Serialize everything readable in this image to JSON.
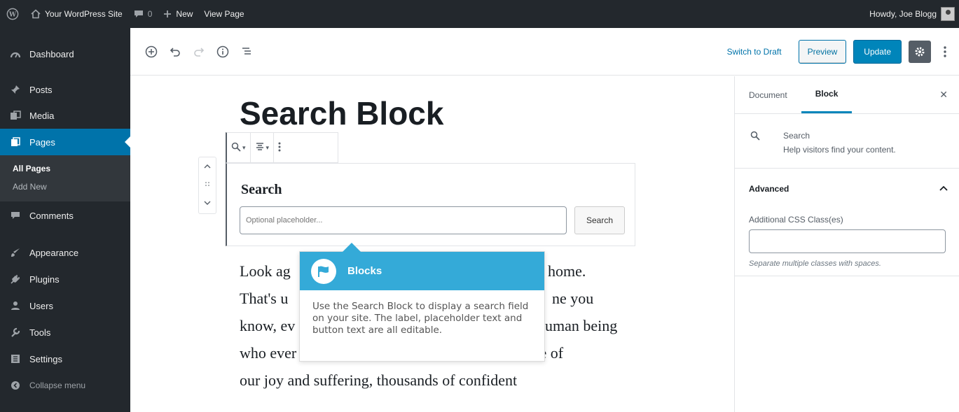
{
  "adminbar": {
    "site_name": "Your WordPress Site",
    "comments_count": "0",
    "new_label": "New",
    "view_page_label": "View Page",
    "howdy": "Howdy, Joe Blogg"
  },
  "sidebar": {
    "items": [
      {
        "label": "Dashboard",
        "icon": "dashboard-icon"
      },
      {
        "label": "Posts",
        "icon": "pin-icon"
      },
      {
        "label": "Media",
        "icon": "media-icon"
      },
      {
        "label": "Pages",
        "icon": "pages-icon"
      },
      {
        "label": "Comments",
        "icon": "comment-icon"
      },
      {
        "label": "Appearance",
        "icon": "brush-icon"
      },
      {
        "label": "Plugins",
        "icon": "plug-icon"
      },
      {
        "label": "Users",
        "icon": "users-icon"
      },
      {
        "label": "Tools",
        "icon": "wrench-icon"
      },
      {
        "label": "Settings",
        "icon": "settings-icon"
      }
    ],
    "submenu": [
      "All Pages",
      "Add New"
    ],
    "collapse_label": "Collapse menu"
  },
  "toolbar": {
    "switch_to_draft": "Switch to Draft",
    "preview": "Preview",
    "update": "Update"
  },
  "editor": {
    "title": "Search Block",
    "search_label": "Search",
    "search_placeholder": "Optional placeholder...",
    "search_button": "Search",
    "paragraph_lines": [
      "Look ag",
      "home.",
      "That's u",
      "ne you",
      "know, ev",
      "uman being",
      "who ever was, lived out their lives. The aggregate of",
      "our joy and suffering, thousands of confident"
    ]
  },
  "popover": {
    "title": "Blocks",
    "body": "Use the Search Block to display a search field on your site. The label, placeholder text and button text are all editable."
  },
  "settings": {
    "tab_document": "Document",
    "tab_block": "Block",
    "block_name": "Search",
    "block_description": "Help visitors find your content.",
    "advanced_title": "Advanced",
    "css_label": "Additional CSS Class(es)",
    "css_help": "Separate multiple classes with spaces."
  },
  "colors": {
    "admin_dark": "#23282d",
    "accent_blue": "#0073aa",
    "primary_button": "#0085ba",
    "popover_blue": "#34aad8"
  }
}
